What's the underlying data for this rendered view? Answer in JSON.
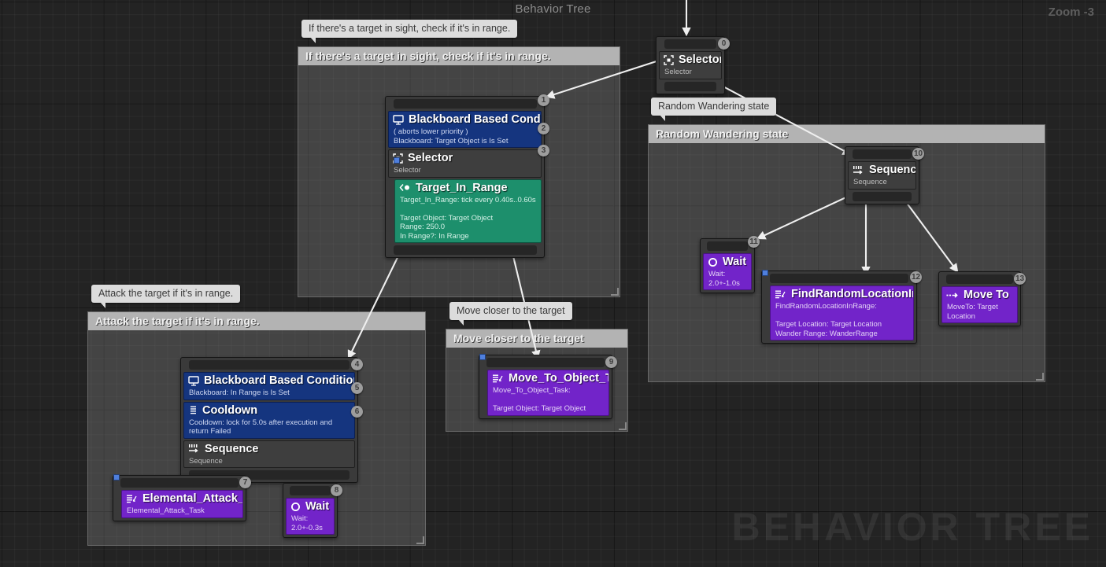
{
  "header": {
    "graph_title": "Behavior Tree",
    "zoom_label": "Zoom -3",
    "watermark": "BEHAVIOR TREE"
  },
  "comments": [
    {
      "id": "c1",
      "title": "If there's a target in sight, check if it's in range.",
      "tooltip": "If there's a target in sight, check if it's in range."
    },
    {
      "id": "c2",
      "title": "Random Wandering state",
      "tooltip": "Random Wandering state"
    },
    {
      "id": "c3",
      "title": "Attack the target if it's in range.",
      "tooltip": "Attack the target if it's in range."
    },
    {
      "id": "c4",
      "title": "Move closer to the target",
      "tooltip": "Move closer to the target"
    }
  ],
  "nodes": {
    "root_selector": {
      "badge": "0",
      "rows": [
        {
          "icon": "selector-icon",
          "kind": "comp",
          "title": "Selector",
          "sub": "Selector"
        }
      ]
    },
    "check_range_stack": {
      "badges": [
        "1",
        "2",
        "3"
      ],
      "rows": [
        {
          "icon": "blackboard-icon",
          "kind": "deco",
          "title": "Blackboard Based Condition",
          "sub": "( aborts lower priority )\nBlackboard: Target Object is Is Set"
        },
        {
          "icon": "selector-icon",
          "kind": "comp",
          "title": "Selector",
          "sub": "Selector"
        },
        {
          "icon": "service-icon",
          "kind": "serv",
          "title": "Target_In_Range",
          "sub": "Target_In_Range: tick every 0.40s..0.60s\n\nTarget Object: Target Object\nRange: 250.0\nIn Range?: In Range"
        }
      ]
    },
    "attack_stack": {
      "badges": [
        "4",
        "5",
        "6"
      ],
      "rows": [
        {
          "icon": "blackboard-icon",
          "kind": "deco",
          "title": "Blackboard Based Condition",
          "sub": "Blackboard: In Range is Is Set"
        },
        {
          "icon": "cooldown-icon",
          "kind": "deco",
          "title": "Cooldown",
          "sub": "Cooldown: lock for 5.0s after execution and return Failed"
        },
        {
          "icon": "sequence-icon",
          "kind": "comp",
          "title": "Sequence",
          "sub": "Sequence"
        }
      ]
    },
    "elemental_attack": {
      "badge": "7",
      "rows": [
        {
          "icon": "task-icon",
          "kind": "task",
          "title": "Elemental_Attack_Task",
          "sub": "Elemental_Attack_Task"
        }
      ]
    },
    "wait_attack": {
      "badge": "8",
      "rows": [
        {
          "icon": "wait-icon",
          "kind": "task",
          "title": "Wait",
          "sub": "Wait: 2.0+-0.3s"
        }
      ]
    },
    "move_to_object": {
      "badge": "9",
      "rows": [
        {
          "icon": "task-icon",
          "kind": "task",
          "title": "Move_To_Object_Task",
          "sub": "Move_To_Object_Task:\n\nTarget Object: Target Object"
        }
      ]
    },
    "wander_sequence": {
      "badge": "10",
      "rows": [
        {
          "icon": "sequence-icon",
          "kind": "comp",
          "title": "Sequence",
          "sub": "Sequence"
        }
      ]
    },
    "wait_wander": {
      "badge": "11",
      "rows": [
        {
          "icon": "wait-icon",
          "kind": "task",
          "title": "Wait",
          "sub": "Wait: 2.0+-1.0s"
        }
      ]
    },
    "find_random_location": {
      "badge": "12",
      "rows": [
        {
          "icon": "task-icon",
          "kind": "task",
          "title": "FindRandomLocationInRange",
          "sub": "FindRandomLocationInRange:\n\nTarget Location: Target Location\nWander Range: WanderRange"
        }
      ]
    },
    "move_to": {
      "badge": "13",
      "rows": [
        {
          "icon": "moveto-icon",
          "kind": "task",
          "title": "Move To",
          "sub": "MoveTo: Target Location"
        }
      ]
    }
  },
  "colors": {
    "decorator": "#15357f",
    "composite": "#3e3e3e",
    "service": "#1d8f6c",
    "task": "#7224c9",
    "comment_header": "#b3b3b3",
    "canvas": "#232323"
  }
}
